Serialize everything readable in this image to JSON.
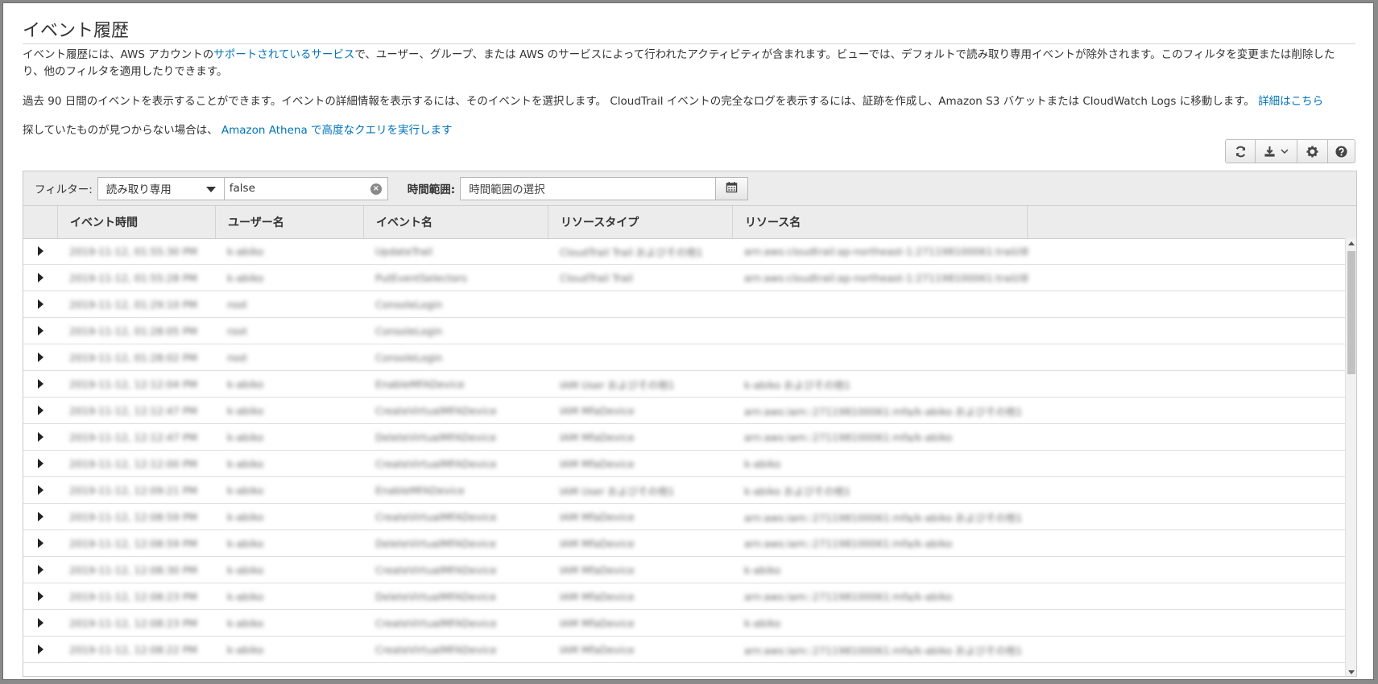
{
  "page": {
    "title": "イベント履歴",
    "intro": {
      "part1": "イベント履歴には、AWS アカウントの",
      "link": "サポートされているサービス",
      "part2": "で、ユーザー、グループ、または AWS のサービスによって行われたアクティビティが含まれます。ビューでは、デフォルトで読み取り専用イベントが除外されます。このフィルタを変更または削除したり、他のフィルタを適用したりできます。"
    },
    "retention": {
      "text": "過去 90 日間のイベントを表示することができます。イベントの詳細情報を表示するには、そのイベントを選択します。 CloudTrail イベントの完全なログを表示するには、証跡を作成し、Amazon S3 バケットまたは CloudWatch Logs に移動します。 ",
      "link": "詳細はこちら"
    },
    "athena": {
      "text": "探していたものが見つからない場合は、 ",
      "link": "Amazon Athena で高度なクエリを実行します"
    }
  },
  "toolbar": {
    "icons": [
      "refresh-icon",
      "download-icon",
      "gear-icon",
      "help-icon"
    ]
  },
  "filter": {
    "label": "フィルター:",
    "attribute": "読み取り専用",
    "value": "false",
    "time_label": "時間範囲:",
    "time_placeholder": "時間範囲の選択"
  },
  "table": {
    "columns": [
      "イベント時間",
      "ユーザー名",
      "イベント名",
      "リソースタイプ",
      "リソース名"
    ],
    "rows": [
      [
        "2019-11-12, 01:55:30 PM",
        "k-abiko",
        "UpdateTrail",
        "CloudTrail Trail およびその他1",
        "arn:aws:cloudtrail:ap-northeast-1:271198100061:trail/iBox..."
      ],
      [
        "2019-11-12, 01:55:28 PM",
        "k-abiko",
        "PutEventSelectors",
        "CloudTrail Trail",
        "arn:aws:cloudtrail:ap-northeast-1:271198100061:trail/iBox..."
      ],
      [
        "2019-11-12, 01:29:10 PM",
        "root",
        "ConsoleLogin",
        "",
        ""
      ],
      [
        "2019-11-12, 01:28:05 PM",
        "root",
        "ConsoleLogin",
        "",
        ""
      ],
      [
        "2019-11-12, 01:28:02 PM",
        "root",
        "ConsoleLogin",
        "",
        ""
      ],
      [
        "2019-11-12, 12:12:04 PM",
        "k-abiko",
        "EnableMFADevice",
        "IAM User およびその他1",
        "k-abiko およびその他1"
      ],
      [
        "2019-11-12, 12:12:47 PM",
        "k-abiko",
        "CreateVirtualMFADevice",
        "IAM MfaDevice",
        "arn:aws:iam::271198100061:mfa/k-abiko およびその他1"
      ],
      [
        "2019-11-12, 12:12:47 PM",
        "k-abiko",
        "DeleteVirtualMFADevice",
        "IAM MfaDevice",
        "arn:aws:iam::271198100061:mfa/k-abiko"
      ],
      [
        "2019-11-12, 12:12:00 PM",
        "k-abiko",
        "CreateVirtualMFADevice",
        "IAM MfaDevice",
        "k-abiko"
      ],
      [
        "2019-11-12, 12:09:21 PM",
        "k-abiko",
        "EnableMFADevice",
        "IAM User およびその他1",
        "k-abiko およびその他1"
      ],
      [
        "2019-11-12, 12:08:59 PM",
        "k-abiko",
        "CreateVirtualMFADevice",
        "IAM MfaDevice",
        "arn:aws:iam::271198100061:mfa/k-abiko およびその他1"
      ],
      [
        "2019-11-12, 12:08:59 PM",
        "k-abiko",
        "DeleteVirtualMFADevice",
        "IAM MfaDevice",
        "arn:aws:iam::271198100061:mfa/k-abiko"
      ],
      [
        "2019-11-12, 12:08:30 PM",
        "k-abiko",
        "CreateVirtualMFADevice",
        "IAM MfaDevice",
        "k-abiko"
      ],
      [
        "2019-11-12, 12:08:23 PM",
        "k-abiko",
        "DeleteVirtualMFADevice",
        "IAM MfaDevice",
        "arn:aws:iam::271198100061:mfa/k-abiko"
      ],
      [
        "2019-11-12, 12:08:23 PM",
        "k-abiko",
        "CreateVirtualMFADevice",
        "IAM MfaDevice",
        "k-abiko"
      ],
      [
        "2019-11-12, 12:08:22 PM",
        "k-abiko",
        "CreateVirtualMFADevice",
        "IAM MfaDevice",
        "arn:aws:iam::271198100061:mfa/k-abiko およびその他1"
      ]
    ]
  },
  "colors": {
    "link": "#0073bb",
    "header_bg": "#ececec"
  }
}
